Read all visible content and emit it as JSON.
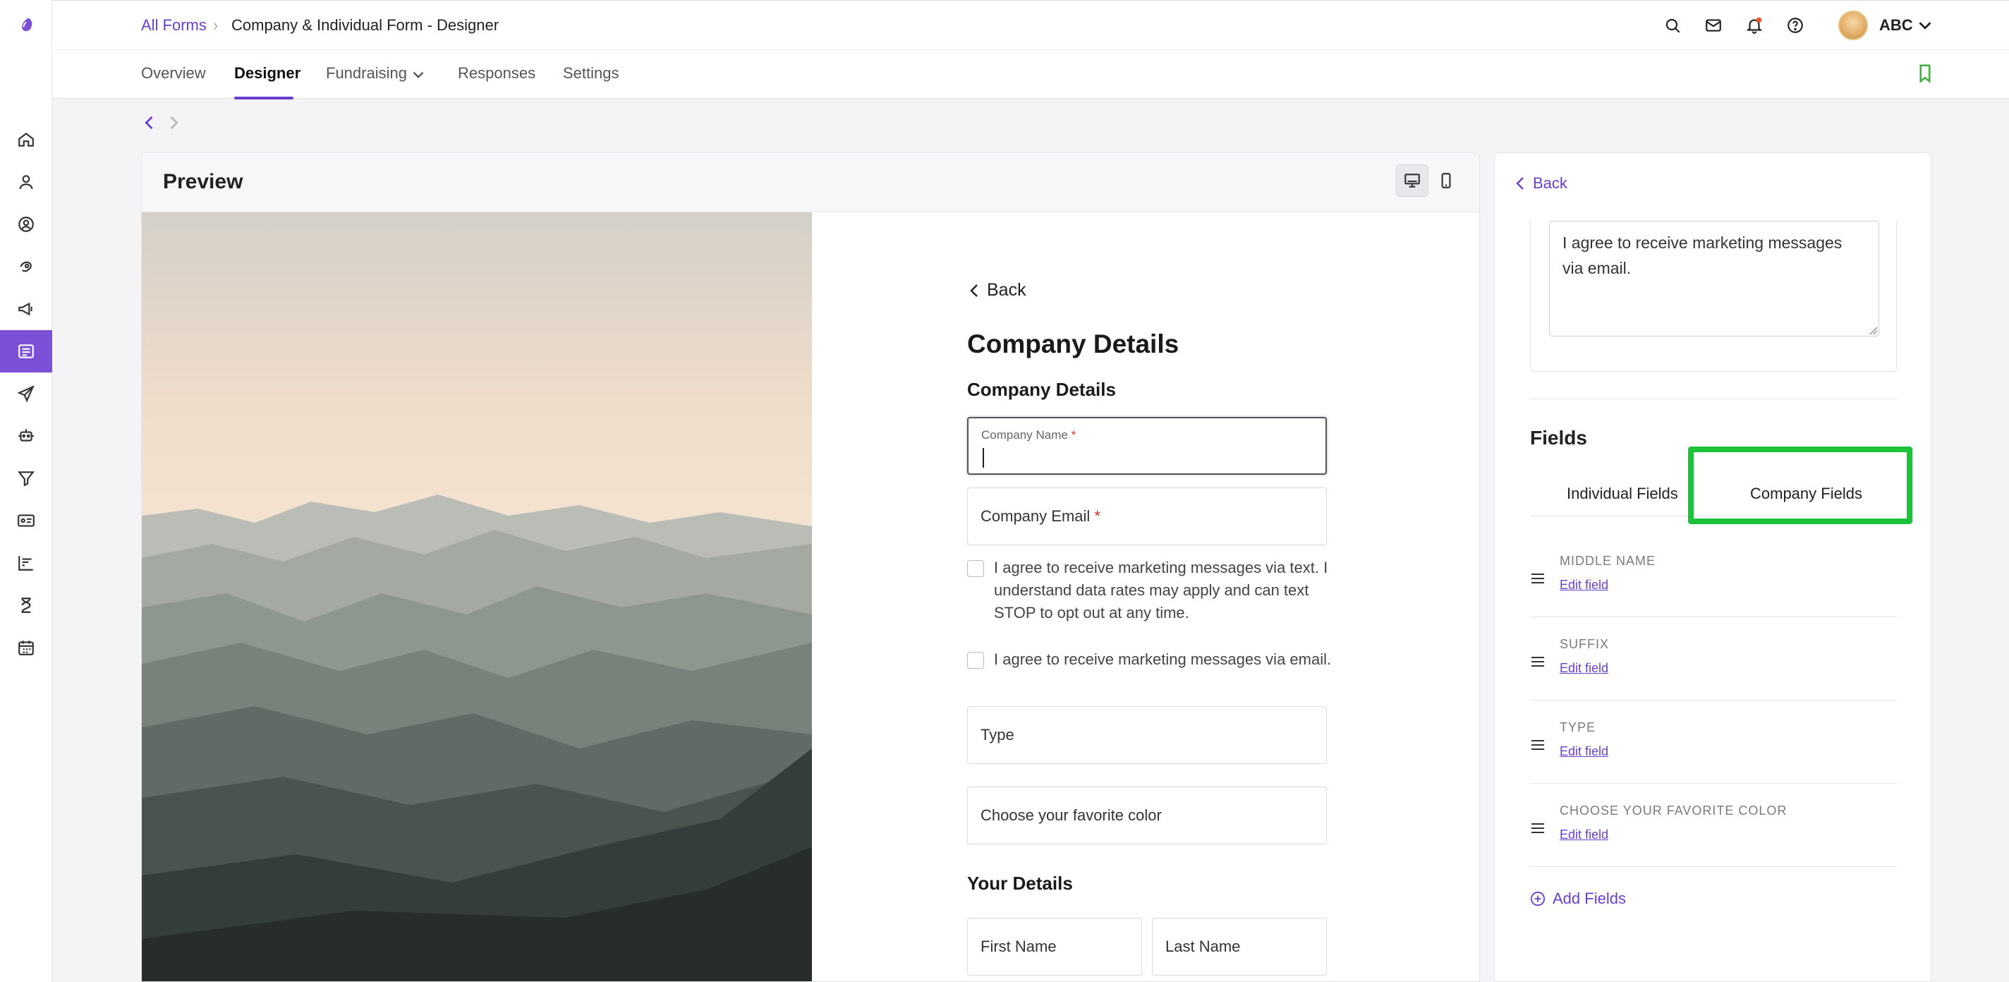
{
  "header": {
    "breadcrumb_root": "All Forms",
    "breadcrumb_sep": "›",
    "breadcrumb_current": "Company & Individual Form - Designer",
    "user_name": "ABC"
  },
  "tabs": [
    {
      "label": "Overview"
    },
    {
      "label": "Designer"
    },
    {
      "label": "Fundraising"
    },
    {
      "label": "Responses"
    },
    {
      "label": "Settings"
    }
  ],
  "preview": {
    "title": "Preview"
  },
  "form": {
    "back_label": "Back",
    "heading": "Company Details",
    "section_company": "Company Details",
    "company_name_label": "Company Name",
    "company_email_label": "Company Email",
    "required_mark": "*",
    "consent_text": "I agree to receive marketing messages via text. I understand data rates may apply and can text STOP to opt out at any time.",
    "consent_email": "I agree to receive marketing messages via email.",
    "type_placeholder": "Type",
    "color_placeholder": "Choose your favorite color",
    "section_your": "Your Details",
    "first_name": "First Name",
    "last_name": "Last Name"
  },
  "panel": {
    "back_label": "Back",
    "textarea_value": "I agree to receive marketing messages via email.",
    "fields_title": "Fields",
    "tab_individual": "Individual Fields",
    "tab_company": "Company Fields",
    "field_rows": [
      {
        "name": "MIDDLE NAME",
        "edit": "Edit field"
      },
      {
        "name": "SUFFIX",
        "edit": "Edit field"
      },
      {
        "name": "TYPE",
        "edit": "Edit field"
      },
      {
        "name": "CHOOSE YOUR FAVORITE COLOR",
        "edit": "Edit field"
      }
    ],
    "add_fields": "Add Fields"
  },
  "colors": {
    "accent": "#6a3fd0",
    "highlight": "#1ec23a",
    "notification": "#e4572e"
  }
}
